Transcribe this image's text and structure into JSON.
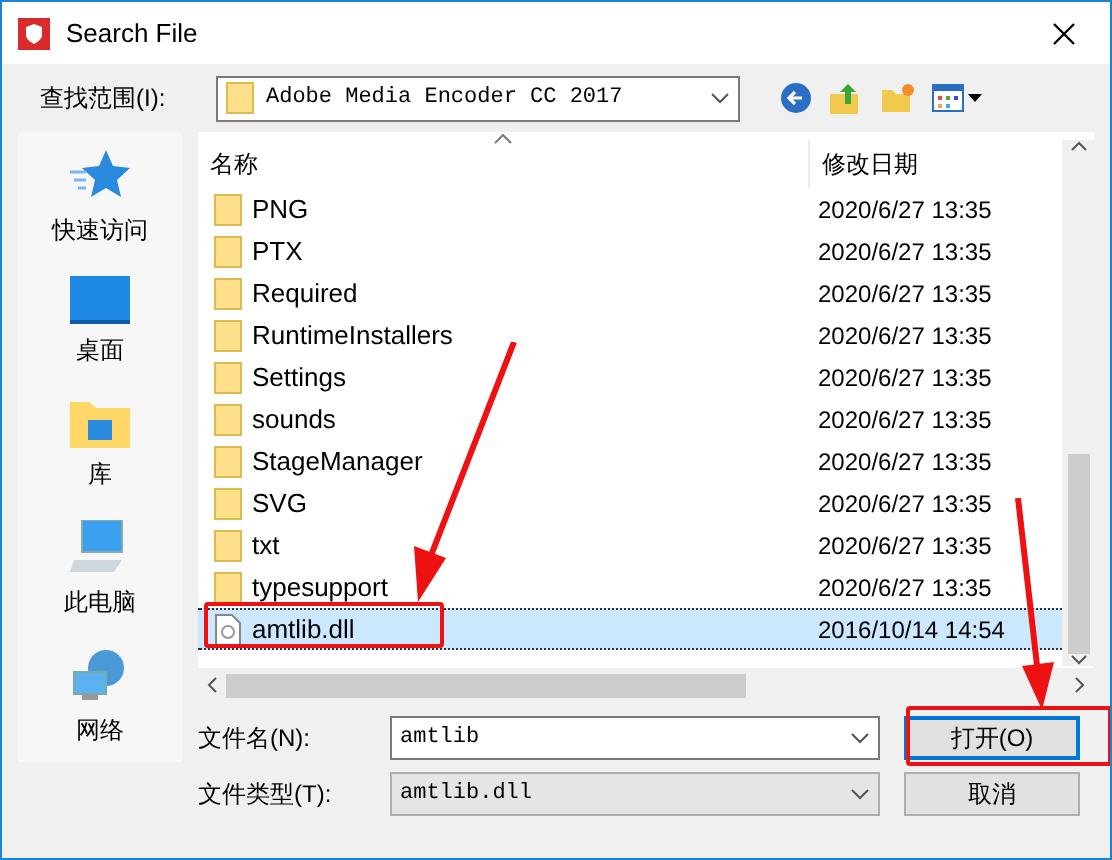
{
  "window": {
    "title": "Search File"
  },
  "look_in": {
    "label": "查找范围(I):",
    "value": "Adobe Media Encoder CC 2017"
  },
  "sidebar": {
    "items": [
      {
        "label": "快速访问",
        "kind": "star"
      },
      {
        "label": "桌面",
        "kind": "desktop"
      },
      {
        "label": "库",
        "kind": "library"
      },
      {
        "label": "此电脑",
        "kind": "computer"
      },
      {
        "label": "网络",
        "kind": "network"
      }
    ]
  },
  "file_list": {
    "columns": [
      "名称",
      "修改日期"
    ],
    "rows": [
      {
        "name": "PNG",
        "modified": "2020/6/27 13:35",
        "kind": "folder",
        "selected": false
      },
      {
        "name": "PTX",
        "modified": "2020/6/27 13:35",
        "kind": "folder",
        "selected": false
      },
      {
        "name": "Required",
        "modified": "2020/6/27 13:35",
        "kind": "folder",
        "selected": false
      },
      {
        "name": "RuntimeInstallers",
        "modified": "2020/6/27 13:35",
        "kind": "folder",
        "selected": false
      },
      {
        "name": "Settings",
        "modified": "2020/6/27 13:35",
        "kind": "folder",
        "selected": false
      },
      {
        "name": "sounds",
        "modified": "2020/6/27 13:35",
        "kind": "folder",
        "selected": false
      },
      {
        "name": "StageManager",
        "modified": "2020/6/27 13:35",
        "kind": "folder",
        "selected": false
      },
      {
        "name": "SVG",
        "modified": "2020/6/27 13:35",
        "kind": "folder",
        "selected": false
      },
      {
        "name": "txt",
        "modified": "2020/6/27 13:35",
        "kind": "folder",
        "selected": false
      },
      {
        "name": "typesupport",
        "modified": "2020/6/27 13:35",
        "kind": "folder",
        "selected": false
      },
      {
        "name": "amtlib.dll",
        "modified": "2016/10/14 14:54",
        "kind": "file",
        "selected": true
      }
    ]
  },
  "file_name": {
    "label": "文件名(N):",
    "value": "amtlib"
  },
  "file_type": {
    "label": "文件类型(T):",
    "value": "amtlib.dll"
  },
  "buttons": [
    {
      "label": "打开(O)",
      "kind": "primary"
    },
    {
      "label": "取消",
      "kind": "normal"
    }
  ]
}
